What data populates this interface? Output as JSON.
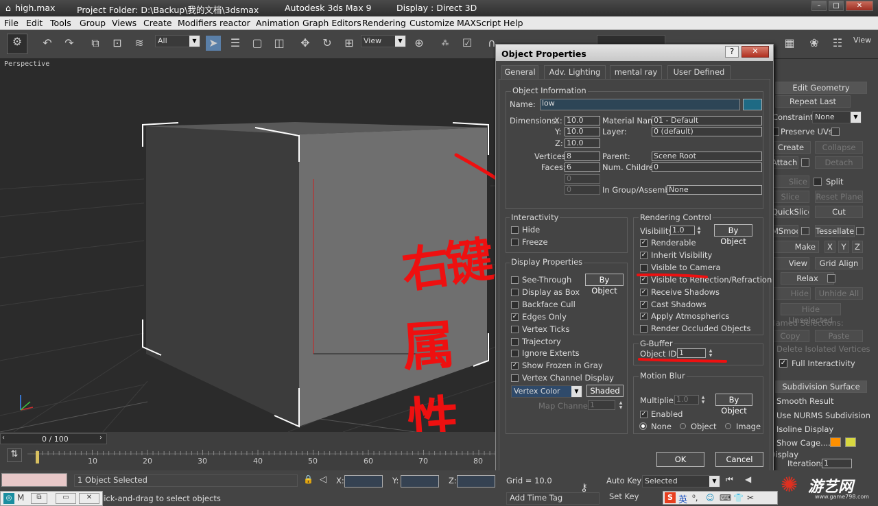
{
  "titlebar": {
    "file": "high.max",
    "project": "Project Folder: D:\\Backup\\我的文档\\3dsmax",
    "app": "Autodesk 3ds Max 9",
    "display": "Display : Direct 3D"
  },
  "menu": [
    "File",
    "Edit",
    "Tools",
    "Group",
    "Views",
    "Create",
    "Modifiers",
    "reactor",
    "Animation",
    "Graph Editors",
    "Rendering",
    "Customize",
    "MAXScript",
    "Help"
  ],
  "toolbar": {
    "selection_filter": "All",
    "ref_coord": "View",
    "view_right": "View"
  },
  "viewport": {
    "label": "Perspective"
  },
  "dialog": {
    "title": "Object Properties",
    "tabs": [
      "General",
      "Adv. Lighting",
      "mental ray",
      "User Defined"
    ],
    "object_info": {
      "group_label": "Object Information",
      "name_label": "Name:",
      "name": "low",
      "color": "#1e6a84",
      "dimensions_label": "Dimensions:",
      "x_label": "X:",
      "y_label": "Y:",
      "z_label": "Z:",
      "dim_x": "10.0",
      "dim_y": "10.0",
      "dim_z": "10.0",
      "vertices_label": "Vertices:",
      "vertices": "8",
      "faces_label": "Faces:",
      "faces": "6",
      "blank1": "0",
      "blank2": "0",
      "material_label": "Material Name:",
      "material": "01 - Default",
      "layer_label": "Layer:",
      "layer": "0 (default)",
      "parent_label": "Parent:",
      "parent": "Scene Root",
      "children_label": "Num. Children:",
      "children": "0",
      "group_asm_label": "In Group/Assembly:",
      "group_asm": "None"
    },
    "interactivity": {
      "label": "Interactivity",
      "hide": "Hide",
      "freeze": "Freeze"
    },
    "display_props": {
      "label": "Display Properties",
      "by_object": "By Object",
      "items": [
        {
          "label": "See-Through",
          "checked": false
        },
        {
          "label": "Display as Box",
          "checked": false
        },
        {
          "label": "Backface Cull",
          "checked": false
        },
        {
          "label": "Edges Only",
          "checked": true
        },
        {
          "label": "Vertex Ticks",
          "checked": false
        },
        {
          "label": "Trajectory",
          "checked": false
        },
        {
          "label": "Ignore Extents",
          "checked": false
        },
        {
          "label": "Show Frozen in Gray",
          "checked": true
        },
        {
          "label": "Vertex Channel Display",
          "checked": false
        }
      ],
      "vertex_color": "Vertex Color",
      "shaded": "Shaded",
      "map_channel_label": "Map Channel:",
      "map_channel": "1"
    },
    "rendering_control": {
      "label": "Rendering Control",
      "visibility_label": "Visibility:",
      "visibility": "1.0",
      "by_object": "By Object",
      "items": [
        {
          "label": "Renderable",
          "checked": true
        },
        {
          "label": "Inherit Visibility",
          "checked": true
        },
        {
          "label": "Visible to Camera",
          "checked": false
        },
        {
          "label": "Visible to Reflection/Refraction",
          "checked": true
        },
        {
          "label": "Receive Shadows",
          "checked": true
        },
        {
          "label": "Cast Shadows",
          "checked": true
        },
        {
          "label": "Apply Atmospherics",
          "checked": true
        },
        {
          "label": "Render Occluded Objects",
          "checked": false
        }
      ]
    },
    "gbuffer": {
      "label": "G-Buffer",
      "object_id_label": "Object ID:",
      "object_id": "1"
    },
    "motion_blur": {
      "label": "Motion Blur",
      "multiplier_label": "Multiplier:",
      "multiplier": "1.0",
      "by_object": "By Object",
      "enabled": "Enabled",
      "none": "None",
      "object": "Object",
      "image": "Image"
    },
    "ok": "OK",
    "cancel": "Cancel"
  },
  "command_panel": {
    "edit_geometry": "Edit Geometry",
    "repeat_last": "Repeat Last",
    "constraints_label": "Constraints:",
    "constraints": "None",
    "preserve_uvs": "Preserve UVs",
    "create": "Create",
    "collapse": "Collapse",
    "attach": "Attach",
    "detach": "Detach",
    "slice_plane": "Slice Plane",
    "split": "Split",
    "slice": "Slice",
    "reset_plane": "Reset Plane",
    "quickslice": "QuickSlice",
    "cut": "Cut",
    "msmooth": "MSmooth",
    "tessellate": "Tessellate",
    "make_planar": "Make Planar",
    "x": "X",
    "y": "Y",
    "z": "Z",
    "view_align": "View Align",
    "grid_align": "Grid Align",
    "relax": "Relax",
    "hide_selected": "Hide Selected",
    "unhide_all": "Unhide All",
    "hide_unselected": "Hide Unselected",
    "named_selections": "Named Selections:",
    "copy": "Copy",
    "paste": "Paste",
    "delete_isolated": "Delete Isolated Vertices",
    "full_interactivity": "Full Interactivity",
    "subdivision_surface": "Subdivision Surface",
    "smooth_result": "Smooth Result",
    "use_nurms": "Use NURMS Subdivision",
    "isoline": "Isoline Display",
    "show_cage": "Show Cage......",
    "display": "Display",
    "iterations_label": "Iterations:",
    "iterations": "1"
  },
  "timeline": {
    "frame": "0 / 100",
    "ticks": [
      "10",
      "20",
      "30",
      "40",
      "50",
      "60",
      "70",
      "80"
    ]
  },
  "status": {
    "selected": "1 Object Selected",
    "x_label": "X:",
    "y_label": "Y:",
    "z_label": "Z:",
    "prompt": "Click-and-drag to select objects",
    "grid": "Grid = 10.0",
    "add_time_tag": "Add Time Tag",
    "auto_key": "Auto Key",
    "set_key": "Set Key",
    "key_mode": "Selected",
    "ime": "英",
    "watermark": "游艺网",
    "watermark_url": "www.game798.com"
  },
  "annotations": {
    "text1": "右键",
    "text2": "属性"
  }
}
